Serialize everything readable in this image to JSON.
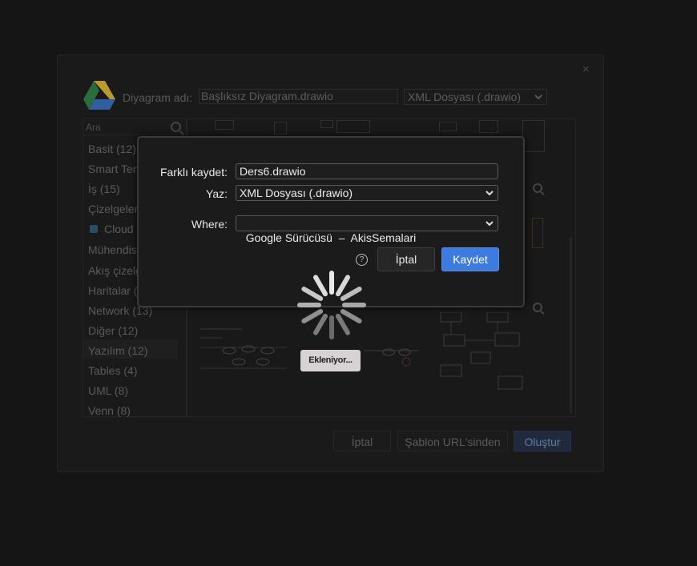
{
  "background_dialog": {
    "name_label": "Diyagram adı:",
    "name_value": "Başlıksız Diyagram.drawio",
    "format_value": "XML Dosyası (.drawio)",
    "close_symbol": "×",
    "search_placeholder": "Ara",
    "categories": [
      "Basit (12)",
      "Smart Ten",
      "İş (15)",
      "Çizelgeler",
      "Cloud",
      "Mühendis",
      "Akış çizelg",
      "Haritalar (",
      "Network (13)",
      "Diğer (12)",
      "Yazılım (12)",
      "Tables (4)",
      "UML (8)",
      "Venn (8)"
    ],
    "active_category": "Yazılım (12)",
    "buttons": {
      "cancel": "İptal",
      "from_template_url": "Şablon URL'sinden",
      "create": "Oluştur"
    }
  },
  "save_dialog": {
    "save_as_label": "Farklı kaydet:",
    "save_as_value": "Ders6.drawio",
    "format_label": "Yaz:",
    "format_value": "XML Dosyası (.drawio)",
    "where_label": "Where:",
    "where_value": "Google Sürücüsü  –  AkisSemalari",
    "help_symbol": "?",
    "cancel_label": "İptal",
    "save_label": "Kaydet"
  },
  "loading": {
    "status_text": "Ekleniyor..."
  },
  "icons": {
    "drive": "google-drive-icon",
    "search": "search-icon",
    "help": "help-icon",
    "spinner": "loading-spinner-icon",
    "chevron": "chevron-down-icon"
  },
  "colors": {
    "accent": "#3e7be0",
    "badge_bg": "#d7d2d3"
  }
}
